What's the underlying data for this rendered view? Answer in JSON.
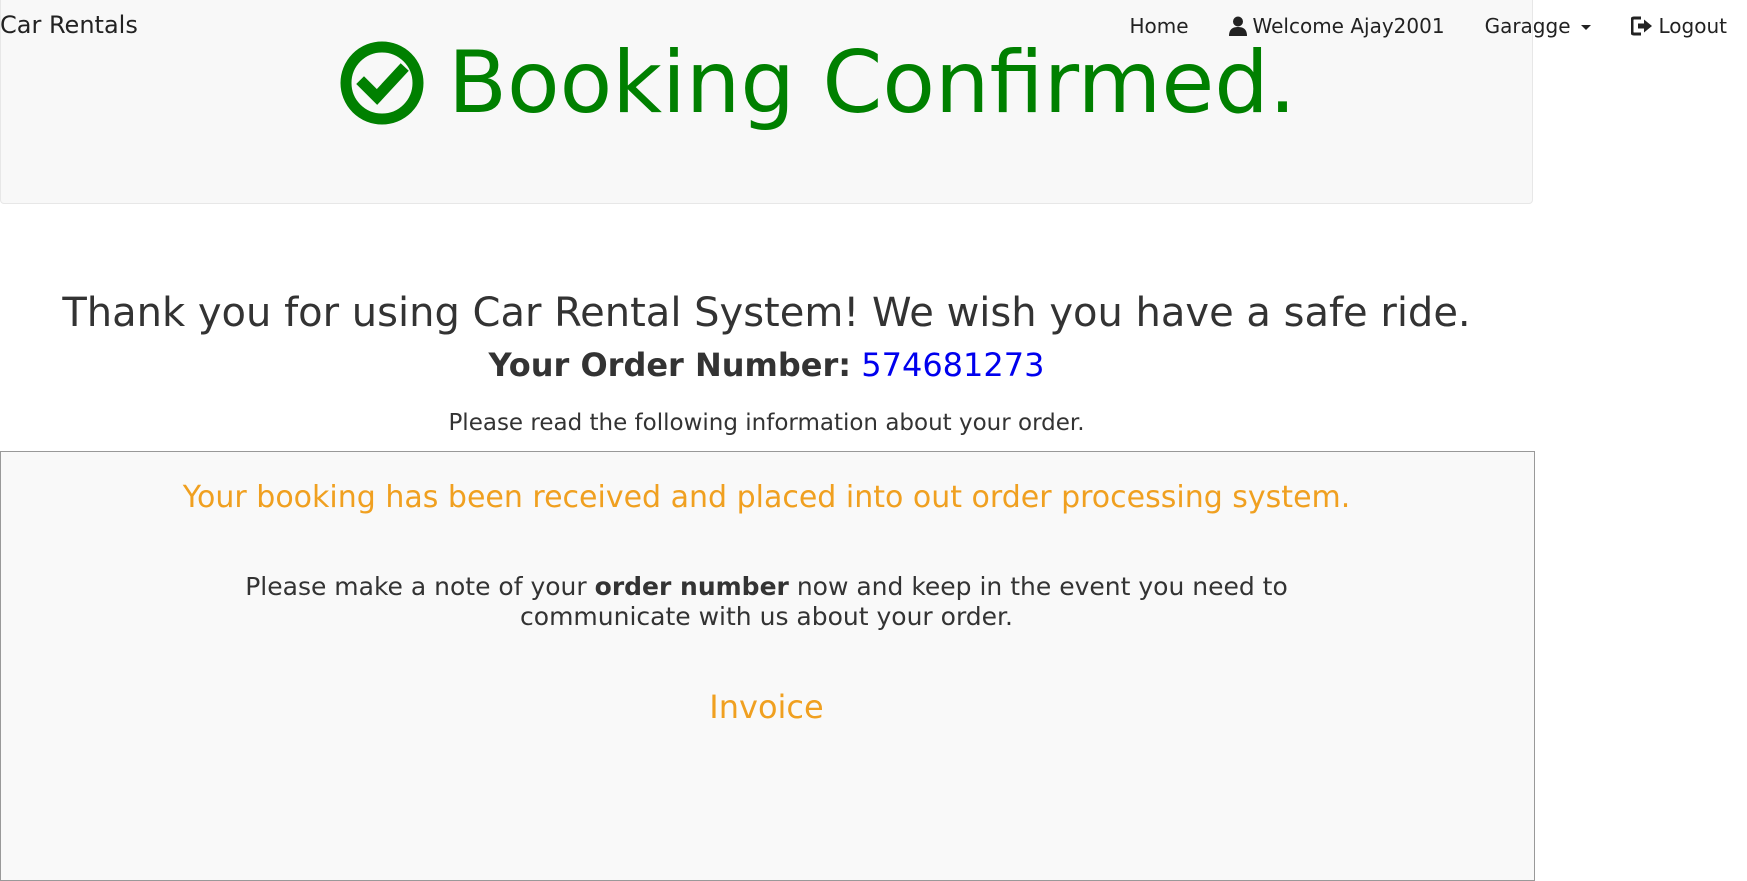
{
  "navbar": {
    "brand": "Car Rentals",
    "home_label": "Home",
    "welcome_label": "Welcome Ajay2001",
    "garage_label": "Garagge",
    "logout_label": "Logout"
  },
  "header": {
    "title": "Booking Confirmed.",
    "title_color": "#008000",
    "icon": "check-circle-icon"
  },
  "confirmation": {
    "thanks": "Thank you for using Car Rental System! We wish you have a safe ride.",
    "order_label": "Your Order Number:",
    "order_number": "574681273",
    "read_info": "Please read the following information about your order."
  },
  "info_box": {
    "received": "Your booking has been received and placed into out order processing system.",
    "note_prefix": "Please make a note of your",
    "note_bold": "order number",
    "note_suffix": "now and keep in the event you need to communicate with us about your order.",
    "invoice_title": "Invoice",
    "accent_color": "#f0a020"
  }
}
